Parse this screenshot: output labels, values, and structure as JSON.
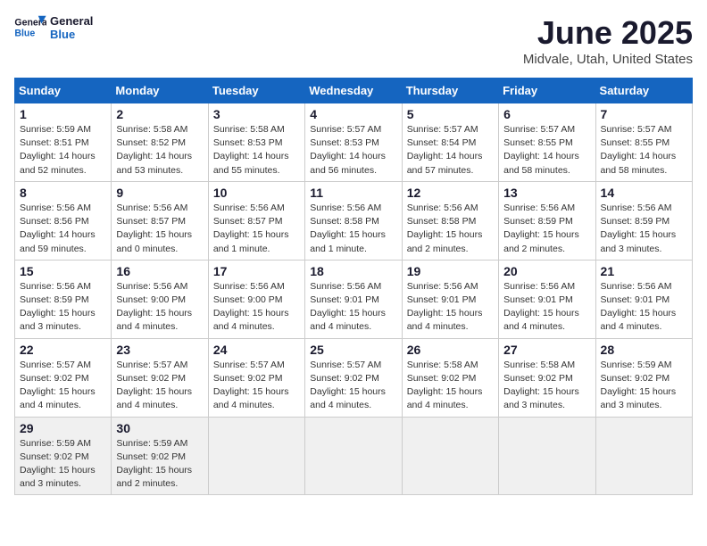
{
  "logo": {
    "general": "General",
    "blue": "Blue"
  },
  "header": {
    "month": "June 2025",
    "location": "Midvale, Utah, United States"
  },
  "weekdays": [
    "Sunday",
    "Monday",
    "Tuesday",
    "Wednesday",
    "Thursday",
    "Friday",
    "Saturday"
  ],
  "weeks": [
    [
      {
        "day": "1",
        "info": "Sunrise: 5:59 AM\nSunset: 8:51 PM\nDaylight: 14 hours\nand 52 minutes."
      },
      {
        "day": "2",
        "info": "Sunrise: 5:58 AM\nSunset: 8:52 PM\nDaylight: 14 hours\nand 53 minutes."
      },
      {
        "day": "3",
        "info": "Sunrise: 5:58 AM\nSunset: 8:53 PM\nDaylight: 14 hours\nand 55 minutes."
      },
      {
        "day": "4",
        "info": "Sunrise: 5:57 AM\nSunset: 8:53 PM\nDaylight: 14 hours\nand 56 minutes."
      },
      {
        "day": "5",
        "info": "Sunrise: 5:57 AM\nSunset: 8:54 PM\nDaylight: 14 hours\nand 57 minutes."
      },
      {
        "day": "6",
        "info": "Sunrise: 5:57 AM\nSunset: 8:55 PM\nDaylight: 14 hours\nand 58 minutes."
      },
      {
        "day": "7",
        "info": "Sunrise: 5:57 AM\nSunset: 8:55 PM\nDaylight: 14 hours\nand 58 minutes."
      }
    ],
    [
      {
        "day": "8",
        "info": "Sunrise: 5:56 AM\nSunset: 8:56 PM\nDaylight: 14 hours\nand 59 minutes."
      },
      {
        "day": "9",
        "info": "Sunrise: 5:56 AM\nSunset: 8:57 PM\nDaylight: 15 hours\nand 0 minutes."
      },
      {
        "day": "10",
        "info": "Sunrise: 5:56 AM\nSunset: 8:57 PM\nDaylight: 15 hours\nand 1 minute."
      },
      {
        "day": "11",
        "info": "Sunrise: 5:56 AM\nSunset: 8:58 PM\nDaylight: 15 hours\nand 1 minute."
      },
      {
        "day": "12",
        "info": "Sunrise: 5:56 AM\nSunset: 8:58 PM\nDaylight: 15 hours\nand 2 minutes."
      },
      {
        "day": "13",
        "info": "Sunrise: 5:56 AM\nSunset: 8:59 PM\nDaylight: 15 hours\nand 2 minutes."
      },
      {
        "day": "14",
        "info": "Sunrise: 5:56 AM\nSunset: 8:59 PM\nDaylight: 15 hours\nand 3 minutes."
      }
    ],
    [
      {
        "day": "15",
        "info": "Sunrise: 5:56 AM\nSunset: 8:59 PM\nDaylight: 15 hours\nand 3 minutes."
      },
      {
        "day": "16",
        "info": "Sunrise: 5:56 AM\nSunset: 9:00 PM\nDaylight: 15 hours\nand 4 minutes."
      },
      {
        "day": "17",
        "info": "Sunrise: 5:56 AM\nSunset: 9:00 PM\nDaylight: 15 hours\nand 4 minutes."
      },
      {
        "day": "18",
        "info": "Sunrise: 5:56 AM\nSunset: 9:01 PM\nDaylight: 15 hours\nand 4 minutes."
      },
      {
        "day": "19",
        "info": "Sunrise: 5:56 AM\nSunset: 9:01 PM\nDaylight: 15 hours\nand 4 minutes."
      },
      {
        "day": "20",
        "info": "Sunrise: 5:56 AM\nSunset: 9:01 PM\nDaylight: 15 hours\nand 4 minutes."
      },
      {
        "day": "21",
        "info": "Sunrise: 5:56 AM\nSunset: 9:01 PM\nDaylight: 15 hours\nand 4 minutes."
      }
    ],
    [
      {
        "day": "22",
        "info": "Sunrise: 5:57 AM\nSunset: 9:02 PM\nDaylight: 15 hours\nand 4 minutes."
      },
      {
        "day": "23",
        "info": "Sunrise: 5:57 AM\nSunset: 9:02 PM\nDaylight: 15 hours\nand 4 minutes."
      },
      {
        "day": "24",
        "info": "Sunrise: 5:57 AM\nSunset: 9:02 PM\nDaylight: 15 hours\nand 4 minutes."
      },
      {
        "day": "25",
        "info": "Sunrise: 5:57 AM\nSunset: 9:02 PM\nDaylight: 15 hours\nand 4 minutes."
      },
      {
        "day": "26",
        "info": "Sunrise: 5:58 AM\nSunset: 9:02 PM\nDaylight: 15 hours\nand 4 minutes."
      },
      {
        "day": "27",
        "info": "Sunrise: 5:58 AM\nSunset: 9:02 PM\nDaylight: 15 hours\nand 3 minutes."
      },
      {
        "day": "28",
        "info": "Sunrise: 5:59 AM\nSunset: 9:02 PM\nDaylight: 15 hours\nand 3 minutes."
      }
    ],
    [
      {
        "day": "29",
        "info": "Sunrise: 5:59 AM\nSunset: 9:02 PM\nDaylight: 15 hours\nand 3 minutes."
      },
      {
        "day": "30",
        "info": "Sunrise: 5:59 AM\nSunset: 9:02 PM\nDaylight: 15 hours\nand 2 minutes."
      },
      null,
      null,
      null,
      null,
      null
    ]
  ]
}
